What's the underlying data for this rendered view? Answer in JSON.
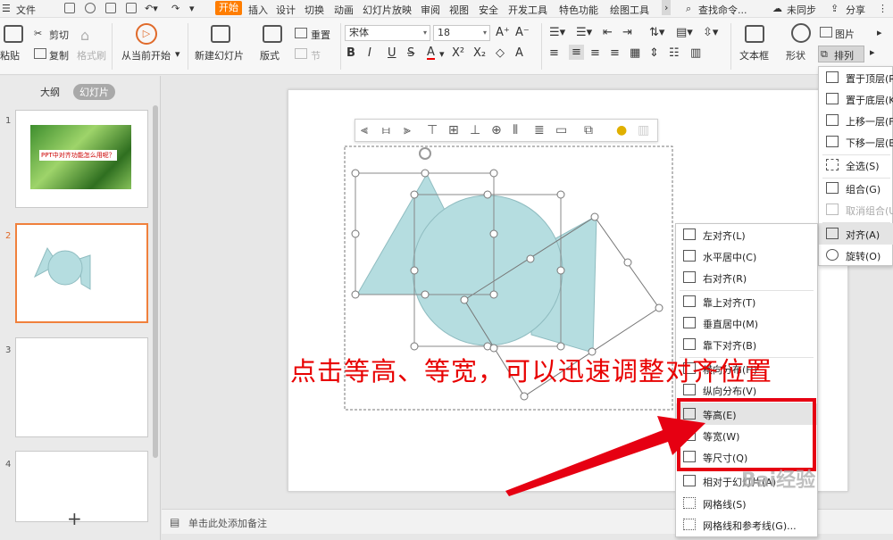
{
  "menubar": {
    "menu_icon": "hamburger-icon",
    "file": "文件",
    "tabs": [
      "开始",
      "插入",
      "设计",
      "切换",
      "动画",
      "幻灯片放映",
      "审阅",
      "视图",
      "安全",
      "开发工具",
      "特色功能",
      "绘图工具"
    ],
    "active_tab": "开始",
    "more": "›",
    "search": "查找命令...",
    "sync": "未同步",
    "share": "分享"
  },
  "ribbon": {
    "paste": "粘贴",
    "cut": "剪切",
    "copy": "复制",
    "format_painter": "格式刷",
    "from_current": "从当前开始",
    "new_slide": "新建幻灯片",
    "layout": "版式",
    "reset": "重置",
    "section": "节",
    "font": "宋体",
    "font_size": "18",
    "textbox": "文本框",
    "shape": "形状",
    "picture": "图片",
    "arrange": "排列"
  },
  "left_pane": {
    "tab_outline": "大纲",
    "tab_slides": "幻灯片",
    "slide_numbers": [
      "1",
      "2",
      "3",
      "4"
    ],
    "slide1_caption": "PPT中对齐功能怎么用呢？",
    "add_slide": "+"
  },
  "notes": {
    "placeholder": "单击此处添加备注"
  },
  "arrange_menu": {
    "items": [
      {
        "label": "置于顶层(R",
        "icon": "bring-to-front-icon",
        "disabled": false
      },
      {
        "label": "置于底层(K",
        "icon": "send-to-back-icon",
        "disabled": false
      },
      {
        "label": "上移一层(F",
        "icon": "bring-forward-icon",
        "disabled": false
      },
      {
        "label": "下移一层(B",
        "icon": "send-backward-icon",
        "disabled": false
      },
      {
        "label": "全选(S)",
        "icon": "select-all-icon",
        "disabled": false
      },
      {
        "label": "组合(G)",
        "icon": "group-icon",
        "disabled": false
      },
      {
        "label": "取消组合(U",
        "icon": "ungroup-icon",
        "disabled": true
      },
      {
        "label": "对齐(A)",
        "icon": "align-icon",
        "disabled": false
      },
      {
        "label": "旋转(O)",
        "icon": "rotate-icon",
        "disabled": false
      }
    ]
  },
  "align_menu": {
    "items": [
      {
        "label": "左对齐(L)",
        "icon": "align-left-icon"
      },
      {
        "label": "水平居中(C)",
        "icon": "align-center-icon"
      },
      {
        "label": "右对齐(R)",
        "icon": "align-right-icon"
      },
      {
        "label": "靠上对齐(T)",
        "icon": "align-top-icon"
      },
      {
        "label": "垂直居中(M)",
        "icon": "align-middle-icon"
      },
      {
        "label": "靠下对齐(B)",
        "icon": "align-bottom-icon"
      },
      {
        "label": "横向分布(H)",
        "icon": "distribute-horizontal-icon"
      },
      {
        "label": "纵向分布(V)",
        "icon": "distribute-vertical-icon"
      },
      {
        "label": "等高(E)",
        "icon": "same-height-icon"
      },
      {
        "label": "等宽(W)",
        "icon": "same-width-icon"
      },
      {
        "label": "等尺寸(Q)",
        "icon": "same-size-icon"
      },
      {
        "label": "相对于幻灯片(A)",
        "icon": "relative-to-slide-icon"
      },
      {
        "label": "网格线(S)",
        "icon": "gridlines-icon"
      },
      {
        "label": "网格线和参考线(G)...",
        "icon": "guides-icon"
      }
    ]
  },
  "annotation": "点击等高、等宽，可以迅速调整对齐位置",
  "watermark": "Bai经验",
  "colors": {
    "accent": "#ff7d00",
    "shape_fill": "#b5dde0",
    "annotation_red": "#e80000",
    "selection_orange": "#f0803c"
  }
}
